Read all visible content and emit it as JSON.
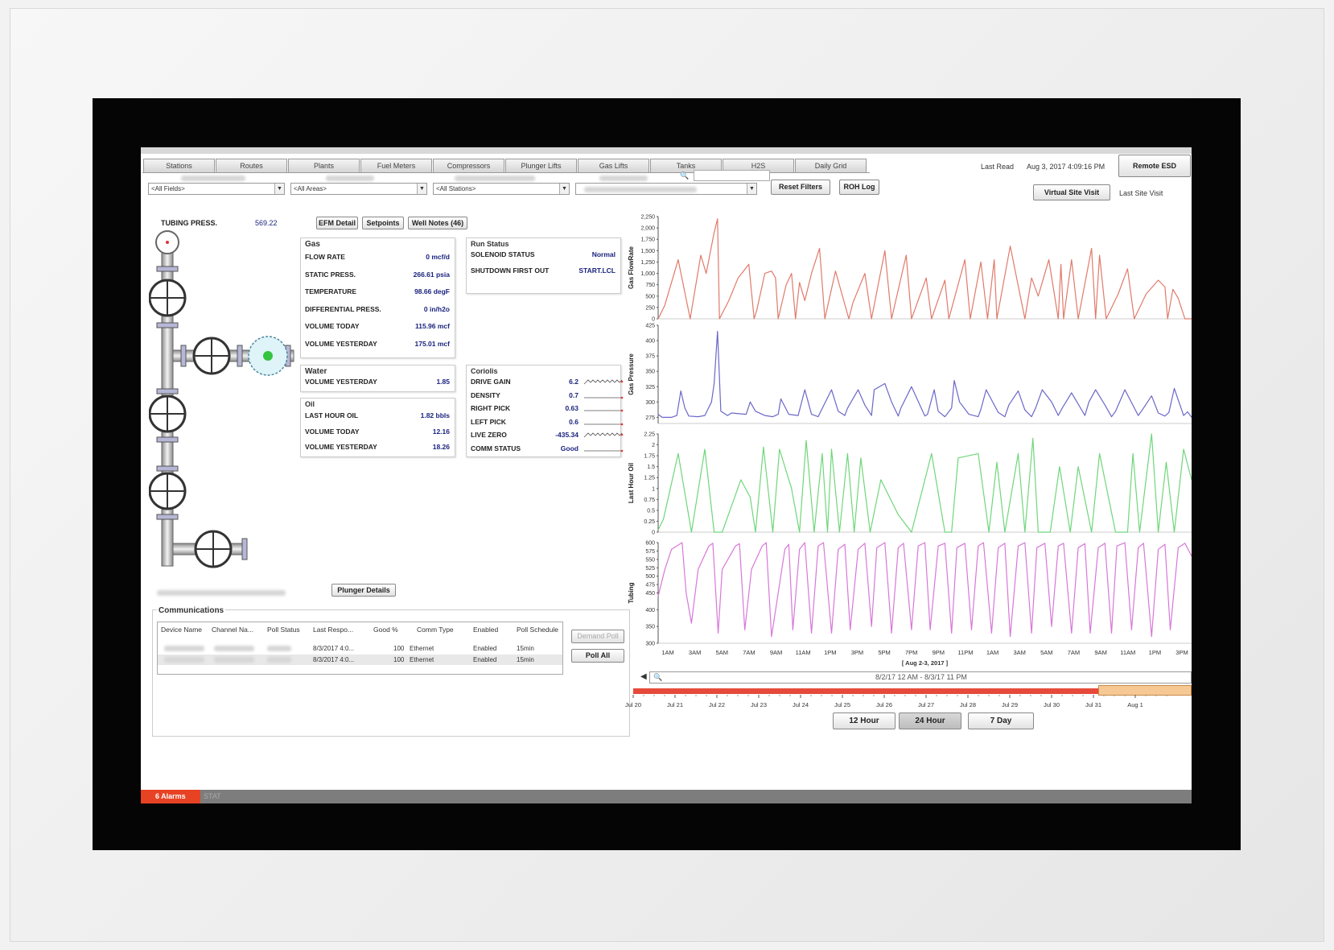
{
  "tabs": [
    "Stations",
    "Routes",
    "Plants",
    "Fuel Meters",
    "Compressors",
    "Plunger Lifts",
    "Gas Lifts",
    "Tanks",
    "H2S",
    "Daily Grid"
  ],
  "header": {
    "last_read_label": "Last Read",
    "last_read_value": "Aug 3, 2017 4:09:16 PM",
    "remote_esd": "Remote ESD"
  },
  "filters": {
    "fields": "<All Fields>",
    "areas": "<All Areas>",
    "stations": "<All Stations>",
    "reset": "Reset Filters",
    "roh_log": "ROH Log",
    "virtual_site_visit": "Virtual Site Visit",
    "last_site_visit": "Last Site Visit"
  },
  "wellhead": {
    "tubing_label": "TUBING PRESS.",
    "tubing_value": "569.22"
  },
  "buttons": {
    "efm_detail": "EFM Detail",
    "setpoints": "Setpoints",
    "well_notes": "Well Notes (46)",
    "plunger_details": "Plunger Details",
    "demand_poll": "Demand Poll",
    "poll_all": "Poll All"
  },
  "gas": {
    "title": "Gas",
    "rows": [
      {
        "label": "FLOW RATE",
        "value": "0 mcf/d"
      },
      {
        "label": "STATIC PRESS.",
        "value": "266.61 psia"
      },
      {
        "label": "TEMPERATURE",
        "value": "98.66 degF"
      },
      {
        "label": "DIFFERENTIAL PRESS.",
        "value": "0 in/h2o"
      },
      {
        "label": "VOLUME TODAY",
        "value": "115.96 mcf"
      },
      {
        "label": "VOLUME YESTERDAY",
        "value": "175.01 mcf"
      }
    ]
  },
  "run_status": {
    "title": "Run Status",
    "rows": [
      {
        "label": "SOLENOID STATUS",
        "value": "Normal"
      },
      {
        "label": "SHUTDOWN FIRST OUT",
        "value": "START.LCL"
      }
    ]
  },
  "water": {
    "title": "Water",
    "rows": [
      {
        "label": "VOLUME YESTERDAY",
        "value": "1.85"
      }
    ]
  },
  "oil": {
    "title": "Oil",
    "rows": [
      {
        "label": "LAST HOUR OIL",
        "value": "1.82 bbls"
      },
      {
        "label": "VOLUME TODAY",
        "value": "12.16"
      },
      {
        "label": "VOLUME YESTERDAY",
        "value": "18.26"
      }
    ]
  },
  "coriolis": {
    "title": "Coriolis",
    "rows": [
      {
        "label": "DRIVE GAIN",
        "value": "6.2"
      },
      {
        "label": "DENSITY",
        "value": "0.7"
      },
      {
        "label": "RIGHT PICK",
        "value": "0.63"
      },
      {
        "label": "LEFT PICK",
        "value": "0.6"
      },
      {
        "label": "LIVE ZERO",
        "value": "-435.34"
      },
      {
        "label": "COMM STATUS",
        "value": "Good"
      }
    ]
  },
  "communications": {
    "title": "Communications",
    "columns": [
      "Device Name",
      "Channel Na...",
      "Poll Status",
      "Last Respo...",
      "Good %",
      "Comm Type",
      "Enabled",
      "Poll Schedule"
    ],
    "rows": [
      {
        "last": "8/3/2017 4:0...",
        "good": "100",
        "type": "Ethernet",
        "enabled": "Enabled",
        "sched": "15min"
      },
      {
        "last": "8/3/2017 4:0...",
        "good": "100",
        "type": "Ethernet",
        "enabled": "Enabled",
        "sched": "15min"
      }
    ]
  },
  "status_bar": {
    "alarms": "6 Alarms",
    "stat": "STAT"
  },
  "charts_axis": {
    "x_ticks": [
      "1AM",
      "3AM",
      "5AM",
      "7AM",
      "9AM",
      "11AM",
      "1PM",
      "3PM",
      "5PM",
      "7PM",
      "9PM",
      "11PM",
      "1AM",
      "3AM",
      "5AM",
      "7AM",
      "9AM",
      "11AM",
      "1PM",
      "3PM"
    ],
    "x_caption": "[ Aug 2-3, 2017 ]"
  },
  "chart_data": [
    {
      "type": "line",
      "ylabel": "Gas FlowRate",
      "color": "#e07a6a",
      "yticks": [
        "2,250",
        "2,000",
        "1,750",
        "1,500",
        "1,250",
        "1,000",
        "750",
        "500",
        "250",
        "0"
      ],
      "ylim": [
        0,
        2250
      ],
      "x": [
        0,
        0.5,
        1.5,
        2.4,
        2.6,
        3.2,
        3.6,
        4.2,
        4.45,
        4.6,
        5.3,
        6.0,
        6.8,
        7.2,
        7.4,
        8.0,
        8.5,
        8.8,
        9.0,
        9.6,
        10.0,
        10.3,
        10.6,
        11.0,
        11.5,
        12.1,
        12.5,
        13.3,
        14.3,
        14.6,
        15.5,
        16.0,
        17.0,
        17.5,
        18.6,
        19.0,
        20.1,
        20.5,
        21.5,
        21.8,
        23.0,
        23.4,
        24.2,
        24.7,
        25.2,
        25.4,
        26.4,
        27.5,
        28.0,
        28.5,
        29.3,
        30.0,
        30.2,
        30.4,
        31.0,
        31.5,
        32.5,
        32.8,
        33.1,
        33.6,
        34.5,
        35.2,
        35.7,
        36.6,
        37.5,
        38.0,
        38.2,
        38.6,
        39.0,
        39.5,
        40.0
      ],
      "y": [
        0,
        300,
        1300,
        0,
        350,
        1400,
        1000,
        1900,
        2200,
        0,
        400,
        900,
        1200,
        0,
        200,
        1000,
        1050,
        900,
        0,
        750,
        1000,
        0,
        800,
        400,
        1000,
        1550,
        0,
        1050,
        0,
        350,
        1000,
        0,
        1500,
        0,
        1400,
        0,
        900,
        0,
        850,
        0,
        1300,
        0,
        1250,
        0,
        1300,
        0,
        1600,
        0,
        900,
        500,
        1300,
        0,
        1200,
        0,
        1300,
        0,
        1550,
        0,
        1400,
        0,
        550,
        1100,
        0,
        550,
        850,
        700,
        0,
        650,
        450,
        0,
        0
      ]
    },
    {
      "type": "line",
      "ylabel": "Gas Pressure",
      "color": "#6b67c8",
      "yticks": [
        "425",
        "400",
        "375",
        "350",
        "325",
        "300",
        "275"
      ],
      "ylim": [
        265,
        425
      ],
      "x": [
        0,
        0.3,
        1.0,
        1.4,
        1.7,
        2.0,
        2.3,
        3.0,
        3.5,
        4.0,
        4.2,
        4.45,
        4.7,
        5.2,
        5.5,
        6.6,
        6.9,
        7.3,
        8.0,
        8.6,
        9.0,
        9.2,
        9.8,
        10.5,
        11.0,
        11.5,
        12.0,
        12.2,
        13.0,
        13.5,
        14.0,
        14.2,
        15.0,
        15.5,
        16.0,
        16.2,
        17.0,
        17.5,
        18.0,
        18.2,
        19.0,
        20.0,
        20.2,
        20.7,
        21.0,
        21.5,
        22.0,
        22.2,
        22.6,
        23.3,
        24.0,
        24.2,
        24.6,
        25.5,
        26.0,
        26.3,
        27.0,
        27.5,
        28.0,
        28.3,
        28.8,
        29.5,
        30.0,
        30.3,
        31.0,
        32.0,
        32.3,
        32.8,
        33.5,
        34.0,
        34.3,
        35.0,
        36.0,
        36.3,
        37.0,
        37.5,
        38.0,
        38.3,
        38.7,
        39.4,
        39.7,
        40.0
      ],
      "y": [
        280,
        275,
        275,
        278,
        318,
        290,
        277,
        276,
        278,
        300,
        330,
        415,
        285,
        278,
        282,
        280,
        300,
        285,
        278,
        276,
        280,
        305,
        280,
        278,
        320,
        280,
        276,
        285,
        320,
        285,
        278,
        290,
        320,
        295,
        278,
        320,
        330,
        300,
        277,
        290,
        325,
        277,
        280,
        320,
        285,
        276,
        290,
        335,
        300,
        280,
        276,
        288,
        320,
        283,
        276,
        295,
        318,
        287,
        276,
        290,
        320,
        300,
        278,
        290,
        315,
        278,
        300,
        320,
        295,
        276,
        285,
        320,
        278,
        287,
        310,
        282,
        277,
        283,
        322,
        278,
        284,
        275
      ]
    },
    {
      "type": "line",
      "ylabel": "Last Hour Oil",
      "color": "#6fd67a",
      "yticks": [
        "2.25",
        "2",
        "1.75",
        "1.5",
        "1.25",
        "1",
        "0.75",
        "0.5",
        "0.25",
        "0"
      ],
      "ylim": [
        0,
        2.25
      ],
      "x": [
        0,
        0.4,
        1.5,
        2.5,
        3.5,
        4.2,
        4.8,
        6.2,
        6.9,
        7.3,
        7.9,
        8.6,
        9.1,
        10.0,
        10.6,
        11.1,
        11.7,
        12.3,
        12.7,
        13.0,
        13.6,
        14.2,
        14.7,
        15.2,
        15.9,
        16.7,
        18.0,
        19.0,
        20.5,
        21.5,
        22.0,
        22.5,
        24.0,
        24.8,
        25.4,
        26.0,
        27.0,
        27.5,
        28.1,
        28.5,
        29.4,
        30.1,
        30.9,
        31.5,
        32.5,
        33.1,
        34.3,
        35.2,
        35.6,
        36.1,
        37.0,
        37.5,
        38.1,
        38.7,
        39.4,
        40.0
      ],
      "y": [
        0.05,
        0.3,
        1.8,
        0,
        1.9,
        0,
        0,
        1.2,
        0.8,
        0,
        1.95,
        0,
        1.9,
        1.0,
        0,
        2.1,
        0,
        1.8,
        0,
        1.9,
        0,
        1.8,
        0,
        1.7,
        0,
        1.2,
        0.4,
        0,
        1.8,
        0,
        0,
        1.7,
        1.8,
        0,
        1.6,
        0,
        1.8,
        0,
        2.15,
        0,
        0,
        1.5,
        0,
        1.5,
        0,
        1.8,
        0,
        0,
        1.8,
        0,
        2.25,
        0,
        1.6,
        0,
        1.9,
        1.2
      ]
    },
    {
      "type": "line",
      "ylabel": "Tubing",
      "color": "#d877d8",
      "yticks": [
        "600",
        "575",
        "550",
        "525",
        "500",
        "475",
        "450",
        "400",
        "350",
        "300"
      ],
      "ylim": [
        300,
        600
      ],
      "x": [
        0,
        0.5,
        1.0,
        1.8,
        2.1,
        2.5,
        3.0,
        3.8,
        4.1,
        4.5,
        4.8,
        5.8,
        6.1,
        6.5,
        7.0,
        7.8,
        8.1,
        8.5,
        9.5,
        9.8,
        10.1,
        10.6,
        11.0,
        11.5,
        12.0,
        12.4,
        13.0,
        13.5,
        14.0,
        14.4,
        15.0,
        15.5,
        16.0,
        16.4,
        17.0,
        17.5,
        18.0,
        18.4,
        19.0,
        19.5,
        20.0,
        20.4,
        21.0,
        21.5,
        22.0,
        22.4,
        23.0,
        23.5,
        24.0,
        24.4,
        25.0,
        25.5,
        26.0,
        26.4,
        27.0,
        27.5,
        28.0,
        28.4,
        29.0,
        29.5,
        30.0,
        30.4,
        31.0,
        31.5,
        32.0,
        32.4,
        33.0,
        33.5,
        34.0,
        34.4,
        35.0,
        35.5,
        36.0,
        36.4,
        37.0,
        37.5,
        38.0,
        38.4,
        39.0,
        39.5,
        40.0
      ],
      "y": [
        440,
        520,
        580,
        600,
        450,
        360,
        520,
        590,
        598,
        330,
        520,
        590,
        597,
        340,
        520,
        590,
        600,
        320,
        580,
        595,
        340,
        580,
        600,
        330,
        590,
        600,
        330,
        580,
        595,
        340,
        580,
        598,
        350,
        585,
        600,
        330,
        585,
        598,
        340,
        590,
        600,
        340,
        590,
        598,
        330,
        585,
        598,
        340,
        590,
        600,
        330,
        585,
        598,
        320,
        590,
        600,
        330,
        585,
        598,
        350,
        590,
        598,
        330,
        585,
        597,
        330,
        585,
        598,
        330,
        590,
        600,
        340,
        585,
        598,
        320,
        580,
        595,
        340,
        585,
        598,
        560
      ]
    }
  ],
  "timeline": {
    "range": "8/2/17 12 AM - 8/3/17 11 PM",
    "ticks": [
      "Jul 20",
      "Jul 21",
      "Jul 22",
      "Jul 23",
      "Jul 24",
      "Jul 25",
      "Jul 26",
      "Jul 27",
      "Jul 28",
      "Jul 29",
      "Jul 30",
      "Jul 31",
      "Aug 1"
    ],
    "btn_12h": "12 Hour",
    "btn_24h": "24 Hour",
    "btn_7d": "7 Day"
  }
}
